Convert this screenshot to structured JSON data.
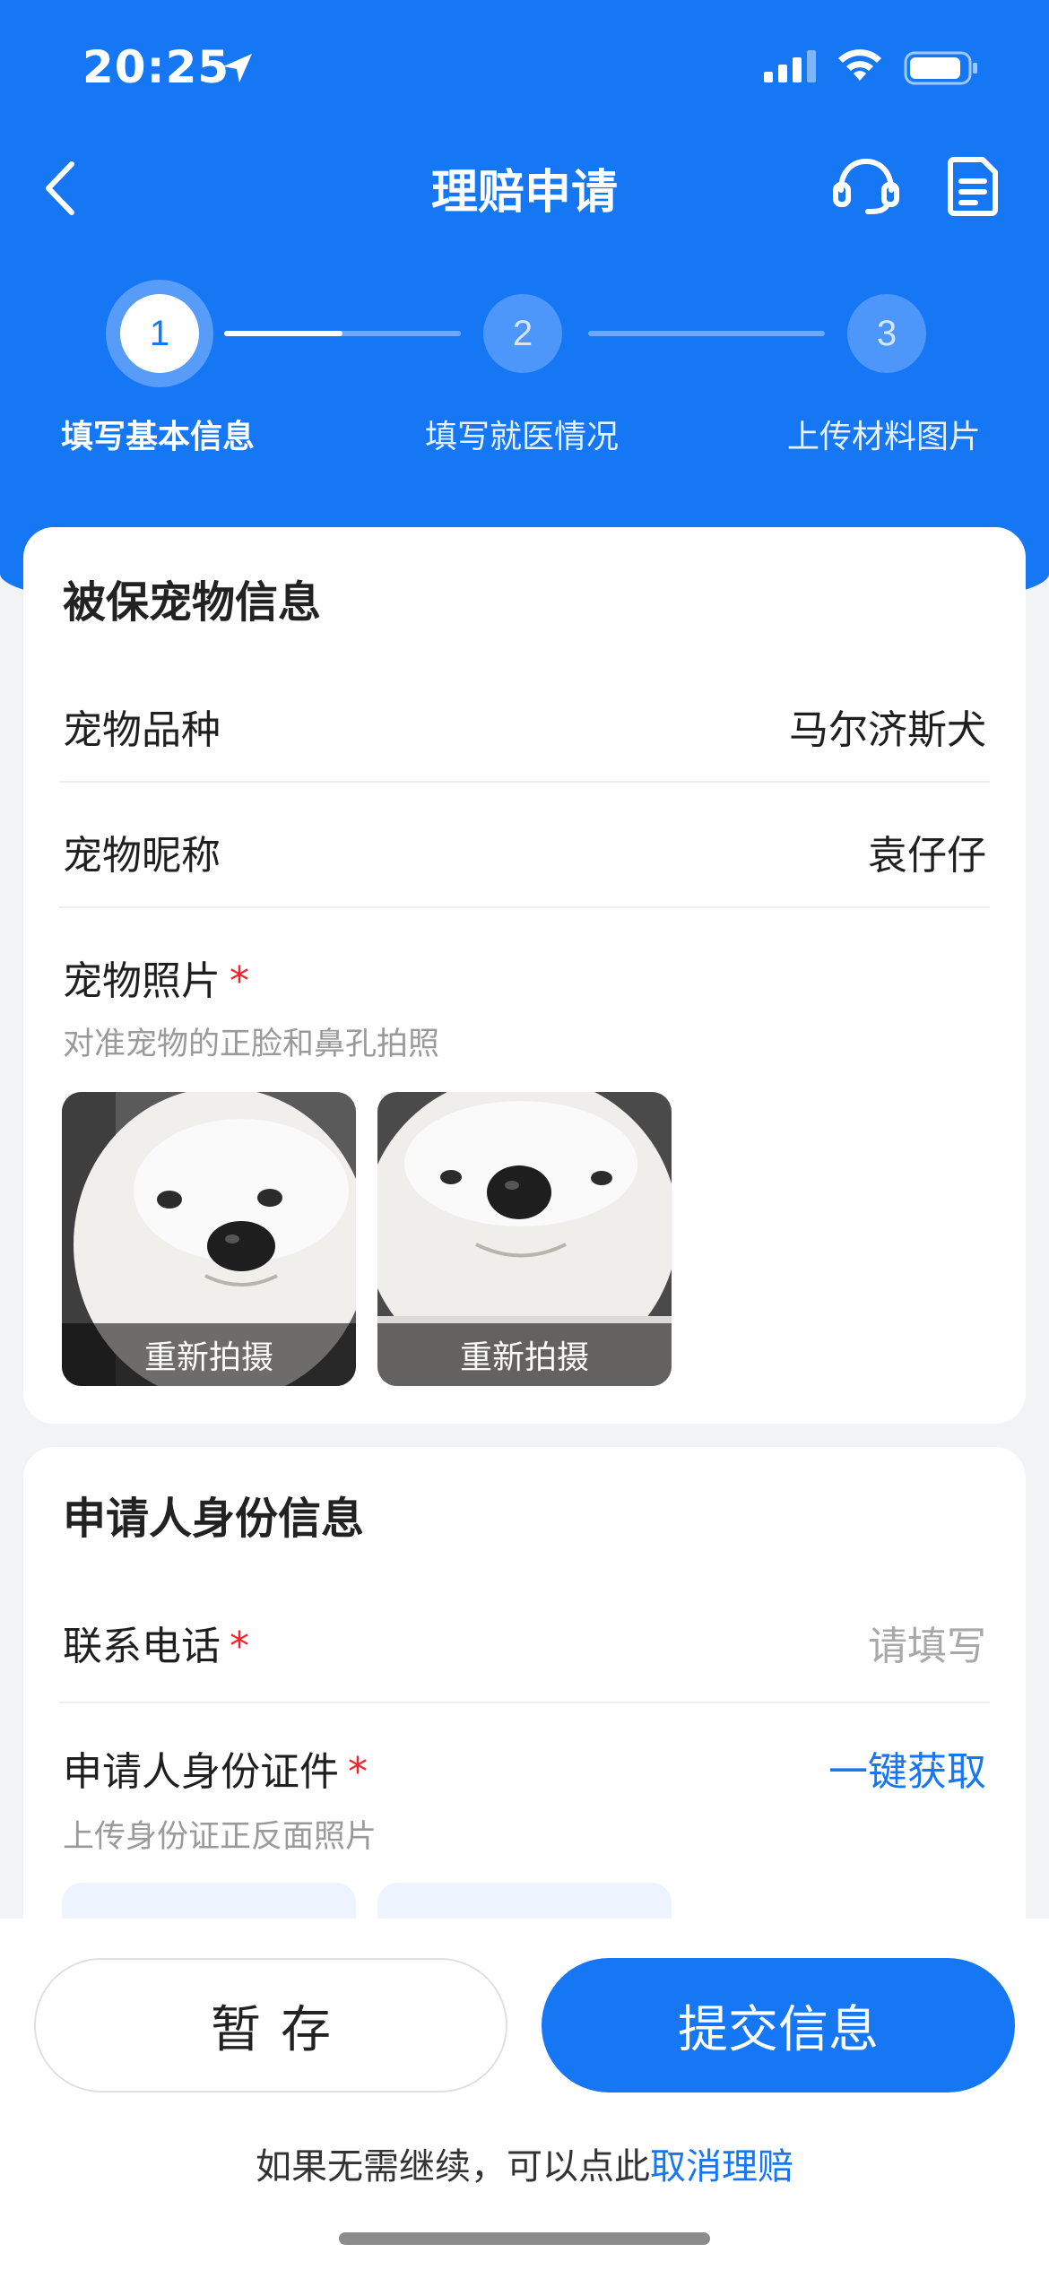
{
  "status_bar": {
    "time": "20:25"
  },
  "nav": {
    "title": "理赔申请"
  },
  "steps": [
    {
      "number": "1",
      "label": "填写基本信息"
    },
    {
      "number": "2",
      "label": "填写就医情况"
    },
    {
      "number": "3",
      "label": "上传材料图片"
    }
  ],
  "pet_info": {
    "title": "被保宠物信息",
    "breed_label": "宠物品种",
    "breed_value": "马尔济斯犬",
    "nickname_label": "宠物昵称",
    "nickname_value": "袁仔仔",
    "photo_label": "宠物照片",
    "required_mark": "*",
    "photo_hint": "对准宠物的正脸和鼻孔拍照",
    "photos": [
      {
        "action": "重新拍摄"
      },
      {
        "action": "重新拍摄"
      }
    ]
  },
  "applicant_info": {
    "title": "申请人身份信息",
    "phone_label": "联系电话",
    "phone_placeholder": "请填写",
    "id_label": "申请人身份证件",
    "id_link": "一键获取",
    "id_hint": "上传身份证正反面照片"
  },
  "actions": {
    "save_label": "暂存",
    "submit_label": "提交信息"
  },
  "footer": {
    "note": "如果无需继续，可以点此",
    "cancel_link": "取消理赔"
  },
  "colors": {
    "primary": "#1677f5",
    "required": "#f5222d"
  }
}
